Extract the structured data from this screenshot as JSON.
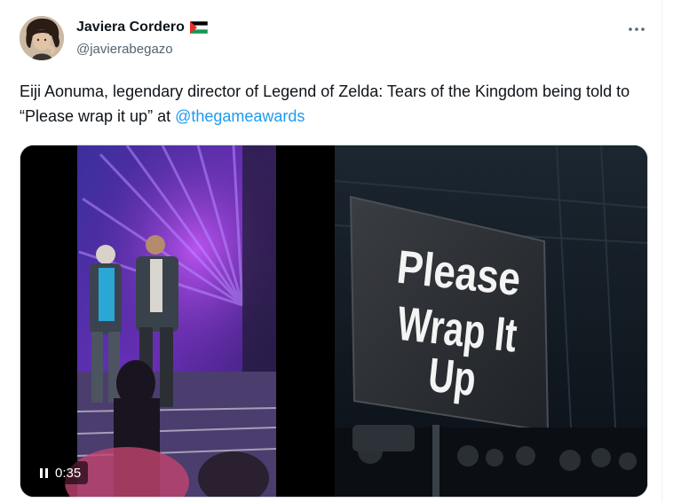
{
  "author": {
    "display_name": "Javiera Cordero",
    "handle": "@javierabegazo",
    "flag_icon": "palestine-flag-icon"
  },
  "tweet": {
    "text_before": "Eiji Aonuma, legendary director of Legend of Zelda: Tears of the Kingdom being told to “Please wrap it up” at ",
    "mention": "@thegameawards"
  },
  "media": {
    "video": {
      "duration": "0:35",
      "state_icon": "pause-icon"
    },
    "photo": {
      "sign_line1": "Please",
      "sign_line2": "Wrap It Up"
    }
  },
  "colors": {
    "link": "#1d9bf0",
    "secondary_text": "#536471",
    "primary_text": "#0f1419"
  },
  "icons": {
    "more": "more-options-icon"
  }
}
